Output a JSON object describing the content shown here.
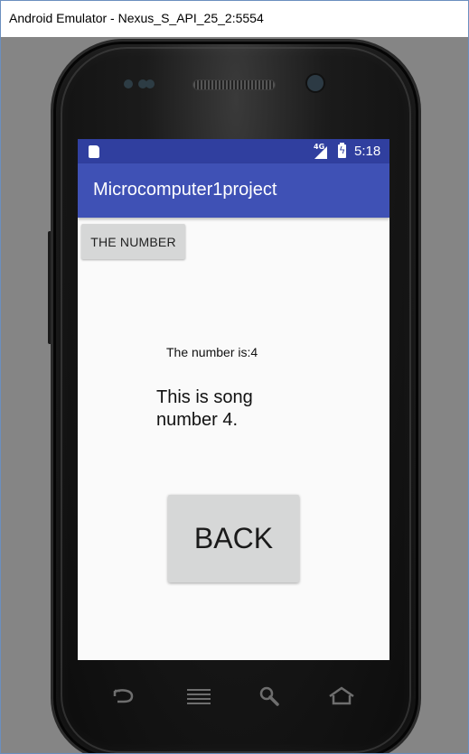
{
  "window": {
    "title": "Android Emulator - Nexus_S_API_25_2:5554"
  },
  "statusbar": {
    "network": "4G",
    "time": "5:18"
  },
  "appbar": {
    "title": "Microcomputer1project"
  },
  "main": {
    "number_button_label": "THE NUMBER",
    "number_text": "The number is:4",
    "song_text": "This is song number 4.",
    "back_button_label": "BACK"
  },
  "colors": {
    "statusbar": "#303f9f",
    "appbar": "#3f51b5",
    "button": "#d6d7d7",
    "screen_bg": "#fafafa"
  },
  "hardware_keys": [
    "back-icon",
    "menu-icon",
    "search-icon",
    "home-icon"
  ]
}
